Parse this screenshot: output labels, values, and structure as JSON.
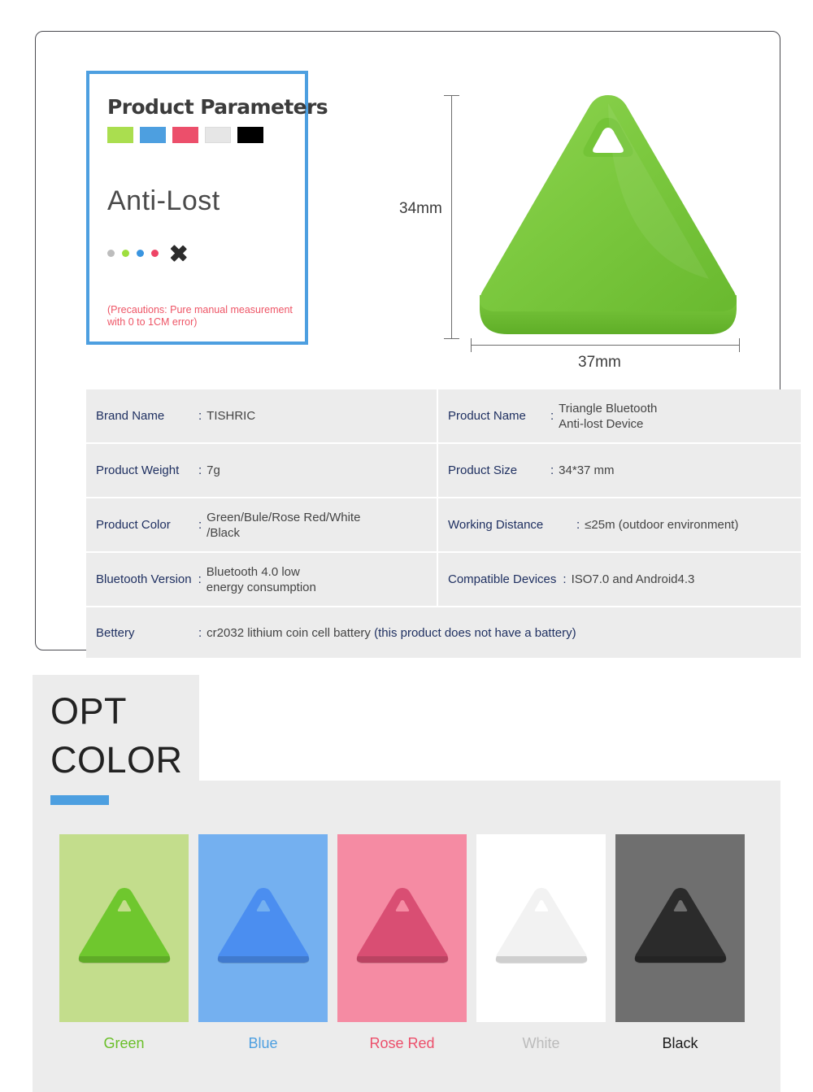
{
  "param_panel": {
    "title": "Product Parameters",
    "swatches": [
      {
        "name": "green-swatch",
        "color": "#aade4f"
      },
      {
        "name": "blue-swatch",
        "color": "#4d9fe0"
      },
      {
        "name": "rose-swatch",
        "color": "#ec4f6b"
      },
      {
        "name": "white-swatch",
        "color": "#e6e6e6"
      },
      {
        "name": "black-swatch",
        "color": "#000000"
      }
    ],
    "headline": "Anti-Lost",
    "dots": [
      {
        "name": "gray-dot",
        "color": "#bdbdbd"
      },
      {
        "name": "green-dot",
        "color": "#9ede3e"
      },
      {
        "name": "blue-dot",
        "color": "#3a95e0"
      },
      {
        "name": "rose-dot",
        "color": "#ee4466"
      }
    ],
    "precaution": "(Precautions: Pure manual measurement with 0 to 1CM error)",
    "precaution_color": "#ee5566",
    "border_color": "#4d9fe0"
  },
  "dimensions": {
    "height_label": "34mm",
    "width_label": "37mm"
  },
  "hero": {
    "product_color": "#7ac943",
    "name": "green triangle bluetooth anti-lost tag"
  },
  "spec_table": {
    "rows": [
      {
        "left": {
          "label": "Brand Name",
          "colon": ":",
          "value": "TISHRIC"
        },
        "right": {
          "label": "Product Name",
          "colon": ":",
          "value": "Triangle Bluetooth\n Anti-lost Device"
        }
      },
      {
        "left": {
          "label": "Product Weight",
          "colon": ":",
          "value": "7g"
        },
        "right": {
          "label": "Product Size",
          "colon": ":",
          "value": "34*37 mm"
        }
      },
      {
        "left": {
          "label": "Product Color",
          "colon": ":",
          "value": "Green/Bule/Rose Red/White\n/Black"
        },
        "right": {
          "label": "Working Distance",
          "colon": ":",
          "value": "≤25m (outdoor environment)"
        }
      },
      {
        "left": {
          "label": "Bluetooth Version",
          "colon": ":",
          "value": "Bluetooth 4.0 low\nenergy consumption"
        },
        "right": {
          "label": "Compatible Devices",
          "colon": ":",
          "value": "ISO7.0 and Android4.3"
        }
      }
    ],
    "battery_row": {
      "label": "Bettery",
      "colon": ":",
      "value": "cr2032 lithium coin cell battery ",
      "value_note": "(this product does not have a battery)"
    },
    "label_color": "#1f3061",
    "value_color": "#444444",
    "cell_bg": "#ececec"
  },
  "opt_color": {
    "title_line1": "OPT",
    "title_line2": "COLOR",
    "accent_color": "#4d9fe0",
    "items": [
      {
        "label": "Green",
        "tile_bg": "#c3dd8c",
        "tag_color": "#6fc72e",
        "label_color": "#6abf29"
      },
      {
        "label": "Blue",
        "tile_bg": "#74b0f0",
        "tag_color": "#4b8ef0",
        "label_color": "#4d9fe0"
      },
      {
        "label": "Rose Red",
        "tile_bg": "#f58ba3",
        "tag_color": "#d94e73",
        "label_color": "#ec4f6b"
      },
      {
        "label": "White",
        "tile_bg": "#ffffff",
        "tag_color": "#f2f2f2",
        "label_color": "#bbbbbb"
      },
      {
        "label": "Black",
        "tile_bg": "#6f6f6f",
        "tag_color": "#2b2b2b",
        "label_color": "#1a1a1a"
      }
    ]
  }
}
